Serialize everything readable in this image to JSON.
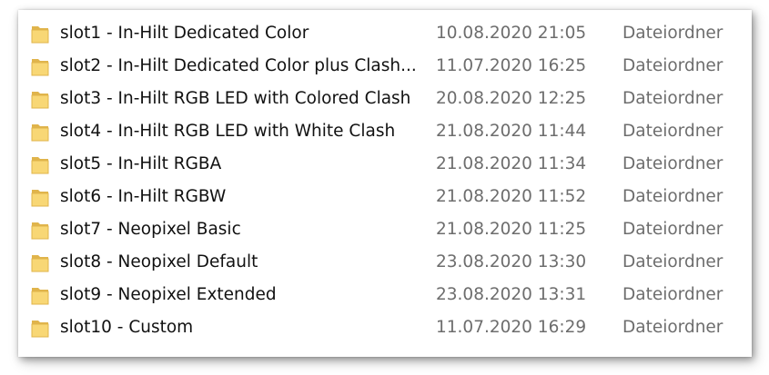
{
  "colors": {
    "folder_fill": "#f8d775",
    "folder_edge": "#e0b44b",
    "name_text": "#111111",
    "meta_text": "#6d6d6d"
  },
  "rows": [
    {
      "icon": "folder-icon",
      "name": "slot1 - In-Hilt Dedicated Color",
      "date": "10.08.2020 21:05",
      "type": "Dateiordner"
    },
    {
      "icon": "folder-icon",
      "name": "slot2 - In-Hilt Dedicated Color plus Clash...",
      "date": "11.07.2020 16:25",
      "type": "Dateiordner"
    },
    {
      "icon": "folder-icon",
      "name": "slot3 - In-Hilt RGB LED with Colored Clash",
      "date": "20.08.2020 12:25",
      "type": "Dateiordner"
    },
    {
      "icon": "folder-icon",
      "name": "slot4 - In-Hilt RGB LED with White Clash",
      "date": "21.08.2020 11:44",
      "type": "Dateiordner"
    },
    {
      "icon": "folder-icon",
      "name": "slot5 - In-Hilt RGBA",
      "date": "21.08.2020 11:34",
      "type": "Dateiordner"
    },
    {
      "icon": "folder-icon",
      "name": "slot6 - In-Hilt RGBW",
      "date": "21.08.2020 11:52",
      "type": "Dateiordner"
    },
    {
      "icon": "folder-icon",
      "name": "slot7 - Neopixel Basic",
      "date": "21.08.2020 11:25",
      "type": "Dateiordner"
    },
    {
      "icon": "folder-icon",
      "name": "slot8 - Neopixel Default",
      "date": "23.08.2020 13:30",
      "type": "Dateiordner"
    },
    {
      "icon": "folder-icon",
      "name": "slot9 - Neopixel Extended",
      "date": "23.08.2020 13:31",
      "type": "Dateiordner"
    },
    {
      "icon": "folder-icon",
      "name": "slot10 - Custom",
      "date": "11.07.2020 16:29",
      "type": "Dateiordner"
    }
  ]
}
